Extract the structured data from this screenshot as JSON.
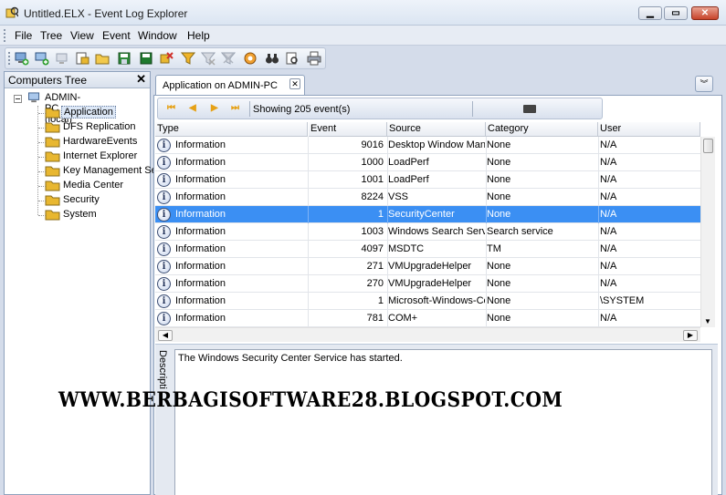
{
  "window": {
    "title": "Untitled.ELX - Event Log Explorer",
    "min_label": "▁",
    "max_label": "▭",
    "close_label": "✕"
  },
  "menu": [
    "File",
    "Tree",
    "View",
    "Event",
    "Window",
    "Help"
  ],
  "toolbar": {
    "icons": [
      "new-computer-icon",
      "add-computer-icon",
      "remove-icon",
      "open-log-icon",
      "open-folder-icon",
      "save-icon",
      "save-as-icon",
      "clear-log-icon",
      "filter-icon",
      "clear-filter-icon",
      "remove-filter-icon",
      "refresh-icon",
      "find-icon",
      "print-preview-icon",
      "print-icon"
    ]
  },
  "left_pane": {
    "title": "Computers Tree",
    "close_label": "✕",
    "root": "ADMIN-PC (local)",
    "logs": [
      "Application",
      "DFS Replication",
      "HardwareEvents",
      "Internet Explorer",
      "Key Management Se",
      "Media Center",
      "Security",
      "System"
    ],
    "selected_index": 0
  },
  "document_tab": {
    "label": "Application on ADMIN-PC",
    "close_label": "✕",
    "dropdown_label": "︾"
  },
  "navbar": {
    "first": "⏮",
    "prev": "◀",
    "next": "▶",
    "last": "⏭",
    "showing": "Showing 205 event(s)"
  },
  "table": {
    "columns": [
      "Type",
      "Event",
      "Source",
      "Category",
      "User"
    ],
    "rows": [
      {
        "type": "Information",
        "event": "9016",
        "source": "Desktop Window Mana",
        "category": "None",
        "user": "N/A"
      },
      {
        "type": "Information",
        "event": "1000",
        "source": "LoadPerf",
        "category": "None",
        "user": "N/A"
      },
      {
        "type": "Information",
        "event": "1001",
        "source": "LoadPerf",
        "category": "None",
        "user": "N/A"
      },
      {
        "type": "Information",
        "event": "8224",
        "source": "VSS",
        "category": "None",
        "user": "N/A"
      },
      {
        "type": "Information",
        "event": "1",
        "source": "SecurityCenter",
        "category": "None",
        "user": "N/A"
      },
      {
        "type": "Information",
        "event": "1003",
        "source": "Windows Search Servi",
        "category": "Search service",
        "user": "N/A"
      },
      {
        "type": "Information",
        "event": "4097",
        "source": "MSDTC",
        "category": "TM",
        "user": "N/A"
      },
      {
        "type": "Information",
        "event": "271",
        "source": "VMUpgradeHelper",
        "category": "None",
        "user": "N/A"
      },
      {
        "type": "Information",
        "event": "270",
        "source": "VMUpgradeHelper",
        "category": "None",
        "user": "N/A"
      },
      {
        "type": "Information",
        "event": "1",
        "source": "Microsoft-Windows-Ce",
        "category": "None",
        "user": "\\SYSTEM"
      },
      {
        "type": "Information",
        "event": "781",
        "source": "COM+",
        "category": "None",
        "user": "N/A"
      }
    ],
    "selected_index": 4,
    "info_glyph": "i"
  },
  "description": {
    "tab_label": "Descripti",
    "text": "The Windows Security Center Service has started."
  },
  "watermark": "WWW.BERBAGISOFTWARE28.BLOGSPOT.COM",
  "colors": {
    "selection": "#3b8ff3",
    "folder": "#e8b730",
    "nav_arrow": "#e6a116"
  }
}
